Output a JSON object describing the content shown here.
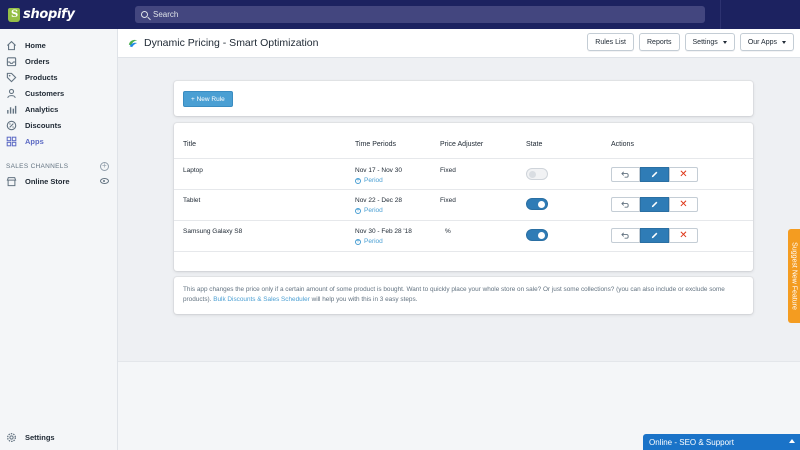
{
  "topbar": {
    "logo_text": "shopify",
    "search_placeholder": "Search"
  },
  "sidebar": {
    "items": [
      {
        "label": "Home",
        "icon": "home-icon"
      },
      {
        "label": "Orders",
        "icon": "orders-icon"
      },
      {
        "label": "Products",
        "icon": "tag-icon"
      },
      {
        "label": "Customers",
        "icon": "person-icon"
      },
      {
        "label": "Analytics",
        "icon": "bar-chart-icon"
      },
      {
        "label": "Discounts",
        "icon": "discount-icon"
      },
      {
        "label": "Apps",
        "icon": "apps-icon",
        "active": true
      }
    ],
    "sales_channels_label": "SALES CHANNELS",
    "online_store_label": "Online Store",
    "settings_label": "Settings"
  },
  "header": {
    "title": "Dynamic Pricing - Smart Optimization",
    "buttons": {
      "rules_list": "Rules List",
      "reports": "Reports",
      "settings": "Settings",
      "our_apps": "Our Apps"
    }
  },
  "new_rule_label": "+ New Rule",
  "table": {
    "headers": {
      "title": "Title",
      "time_periods": "Time Periods",
      "price_adjuster": "Price Adjuster",
      "state": "State",
      "actions": "Actions"
    },
    "period_link": "Period",
    "rows": [
      {
        "title": "Laptop",
        "period": "Nov 17 - Nov 30",
        "adjuster": "Fixed",
        "state": "off"
      },
      {
        "title": "Tablet",
        "period": "Nov 22 - Dec 28",
        "adjuster": "Fixed",
        "state": "on"
      },
      {
        "title": "Samsung Galaxy S8",
        "period": "Nov 30 - Feb 28 '18",
        "adjuster": "%",
        "state": "on"
      }
    ]
  },
  "info": {
    "text_before": "This app changes the price only if a certain amount of some product is bought. Want to quickly place your whole store on sale? Or just some collections? (you can also include or exclude some products). ",
    "link_text": "Bulk Discounts & Sales Scheduler",
    "text_after": " will help you with this in 3 easy steps."
  },
  "feature_tab_label": "Suggest New Feature",
  "support_bar_label": "Online - SEO & Support",
  "colors": {
    "topbar": "#1c2260",
    "accent": "#4a9fd3",
    "toggle_on": "#2f7cb6",
    "delete": "#de3618",
    "feature_tab": "#f49c20",
    "support_bar": "#1a73c8"
  }
}
